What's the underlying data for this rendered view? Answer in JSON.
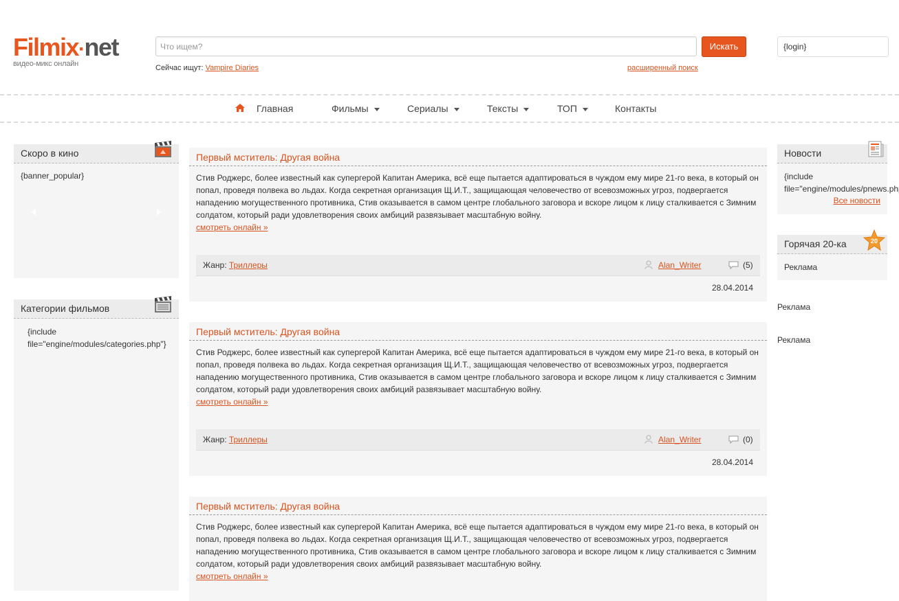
{
  "header": {
    "logo_main_1": "Filmix",
    "logo_dot": "·",
    "logo_main_2": "net",
    "logo_sub": "видео-микс онлайн",
    "search_placeholder": "Что ищем?",
    "search_button": "Искать",
    "login": "{login}",
    "now_search_label": "Сейчас ищут:",
    "now_search_link": "Vampire Diaries",
    "advanced_search": "расширенный поиск"
  },
  "nav": {
    "items": [
      {
        "label": "Главная",
        "dropdown": false
      },
      {
        "label": "Фильмы",
        "dropdown": true
      },
      {
        "label": "Сериалы",
        "dropdown": true
      },
      {
        "label": "Тексты",
        "dropdown": true
      },
      {
        "label": "ТОП",
        "dropdown": true
      },
      {
        "label": "Контакты",
        "dropdown": false
      }
    ]
  },
  "left": {
    "coming_soon_title": "Скоро в кино",
    "coming_soon_body": "{banner_popular}",
    "categories_title": "Категории фильмов",
    "categories_body": "{include file=\"engine/modules/categories.php\"}"
  },
  "right": {
    "news_title": "Новости",
    "news_body": "{include file=\"engine/modules/pnews.php\"}",
    "news_all": "Все новости",
    "hot_title": "Горячая 20-ка",
    "hot_badge": "20",
    "hot_ad": "Реклама",
    "ad_1": "Реклама",
    "ad_2": "Реклама"
  },
  "posts": [
    {
      "title": "Первый мститель: Другая война",
      "text": "Стив Роджерс, более известный как супергерой Капитан Америка, всё еще пытается адаптироваться в чуждом ему мире 21-го века, в который он попал, проведя полвека во льдах. Когда секретная организация Щ.И.Т., защищающая человечество от всевозможных угроз, подвергается нападению могущественного противника, Стив оказывается в самом центре глобального заговора и вскоре лицом к лицу сталкивается с Зимним солдатом, который ради удовлетворения своих амбиций развязывает масштабную войну.",
      "more": "смотреть онлайн »",
      "genre_label": "Жанр:",
      "genre": "Триллеры",
      "author": "Alan_Writer",
      "comments": "(5)",
      "date": "28.04.2014"
    },
    {
      "title": "Первый мститель: Другая война",
      "text": "Стив Роджерс, более известный как супергерой Капитан Америка, всё еще пытается адаптироваться в чуждом ему мире 21-го века, в который он попал, проведя полвека во льдах. Когда секретная организация Щ.И.Т., защищающая человечество от всевозможных угроз, подвергается нападению могущественного противника, Стив оказывается в самом центре глобального заговора и вскоре лицом к лицу сталкивается с Зимним солдатом, который ради удовлетворения своих амбиций развязывает масштабную войну.",
      "more": "смотреть онлайн »",
      "genre_label": "Жанр:",
      "genre": "Триллеры",
      "author": "Alan_Writer",
      "comments": "(0)",
      "date": "28.04.2014"
    },
    {
      "title": "Первый мститель: Другая война",
      "text": "Стив Роджерс, более известный как супергерой Капитан Америка, всё еще пытается адаптироваться в чуждом ему мире 21-го века, в который он попал, проведя полвека во льдах. Когда секретная организация Щ.И.Т., защищающая человечество от всевозможных угроз, подвергается нападению могущественного противника, Стив оказывается в самом центре глобального заговора и вскоре лицом к лицу сталкивается с Зимним солдатом, который ради удовлетворения своих амбиций развязывает масштабную войну.",
      "more": "смотреть онлайн »"
    }
  ],
  "colors": {
    "accent": "#e8561f",
    "link": "#d9531e",
    "panel": "#f5f5f5"
  },
  "icons": [
    "home-icon",
    "caret-down-icon",
    "clapperboard-icon",
    "news-icon",
    "star-badge-icon",
    "user-icon",
    "comment-icon",
    "arrow-left-icon",
    "arrow-right-icon"
  ]
}
